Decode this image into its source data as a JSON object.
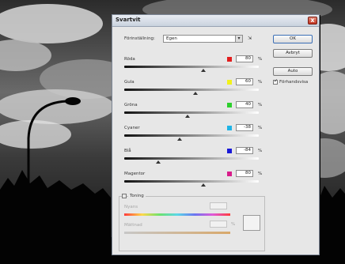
{
  "dialog": {
    "title": "Svartvit",
    "close_glyph": "x",
    "preset_label": "Förinställning:",
    "preset_value": "Egen",
    "preset_arrow": "▾",
    "preset_menu_glyph": "⇲",
    "buttons": {
      "ok": "OK",
      "cancel": "Avbryt",
      "auto": "Auto"
    },
    "preview_label": "Förhandsvisa",
    "preview_checked": true,
    "percent_sign": "%",
    "sliders": [
      {
        "label": "Röda",
        "value": "80",
        "color": "#e21d1d",
        "level": 0.59
      },
      {
        "label": "Gula",
        "value": "60",
        "color": "#f2f21a",
        "level": 0.53
      },
      {
        "label": "Gröna",
        "value": "40",
        "color": "#2ccf2c",
        "level": 0.47
      },
      {
        "label": "Cyaner",
        "value": "-38",
        "color": "#1fb4e6",
        "level": 0.41
      },
      {
        "label": "Blå",
        "value": "-84",
        "color": "#1a1ad8",
        "level": 0.25
      },
      {
        "label": "Magentor",
        "value": "80",
        "color": "#d81c8a",
        "level": 0.59
      }
    ],
    "tint": {
      "label": "Toning",
      "checked": false,
      "hue_label": "Nyans",
      "sat_label": "Mättnad",
      "sat_pct": "%"
    }
  }
}
